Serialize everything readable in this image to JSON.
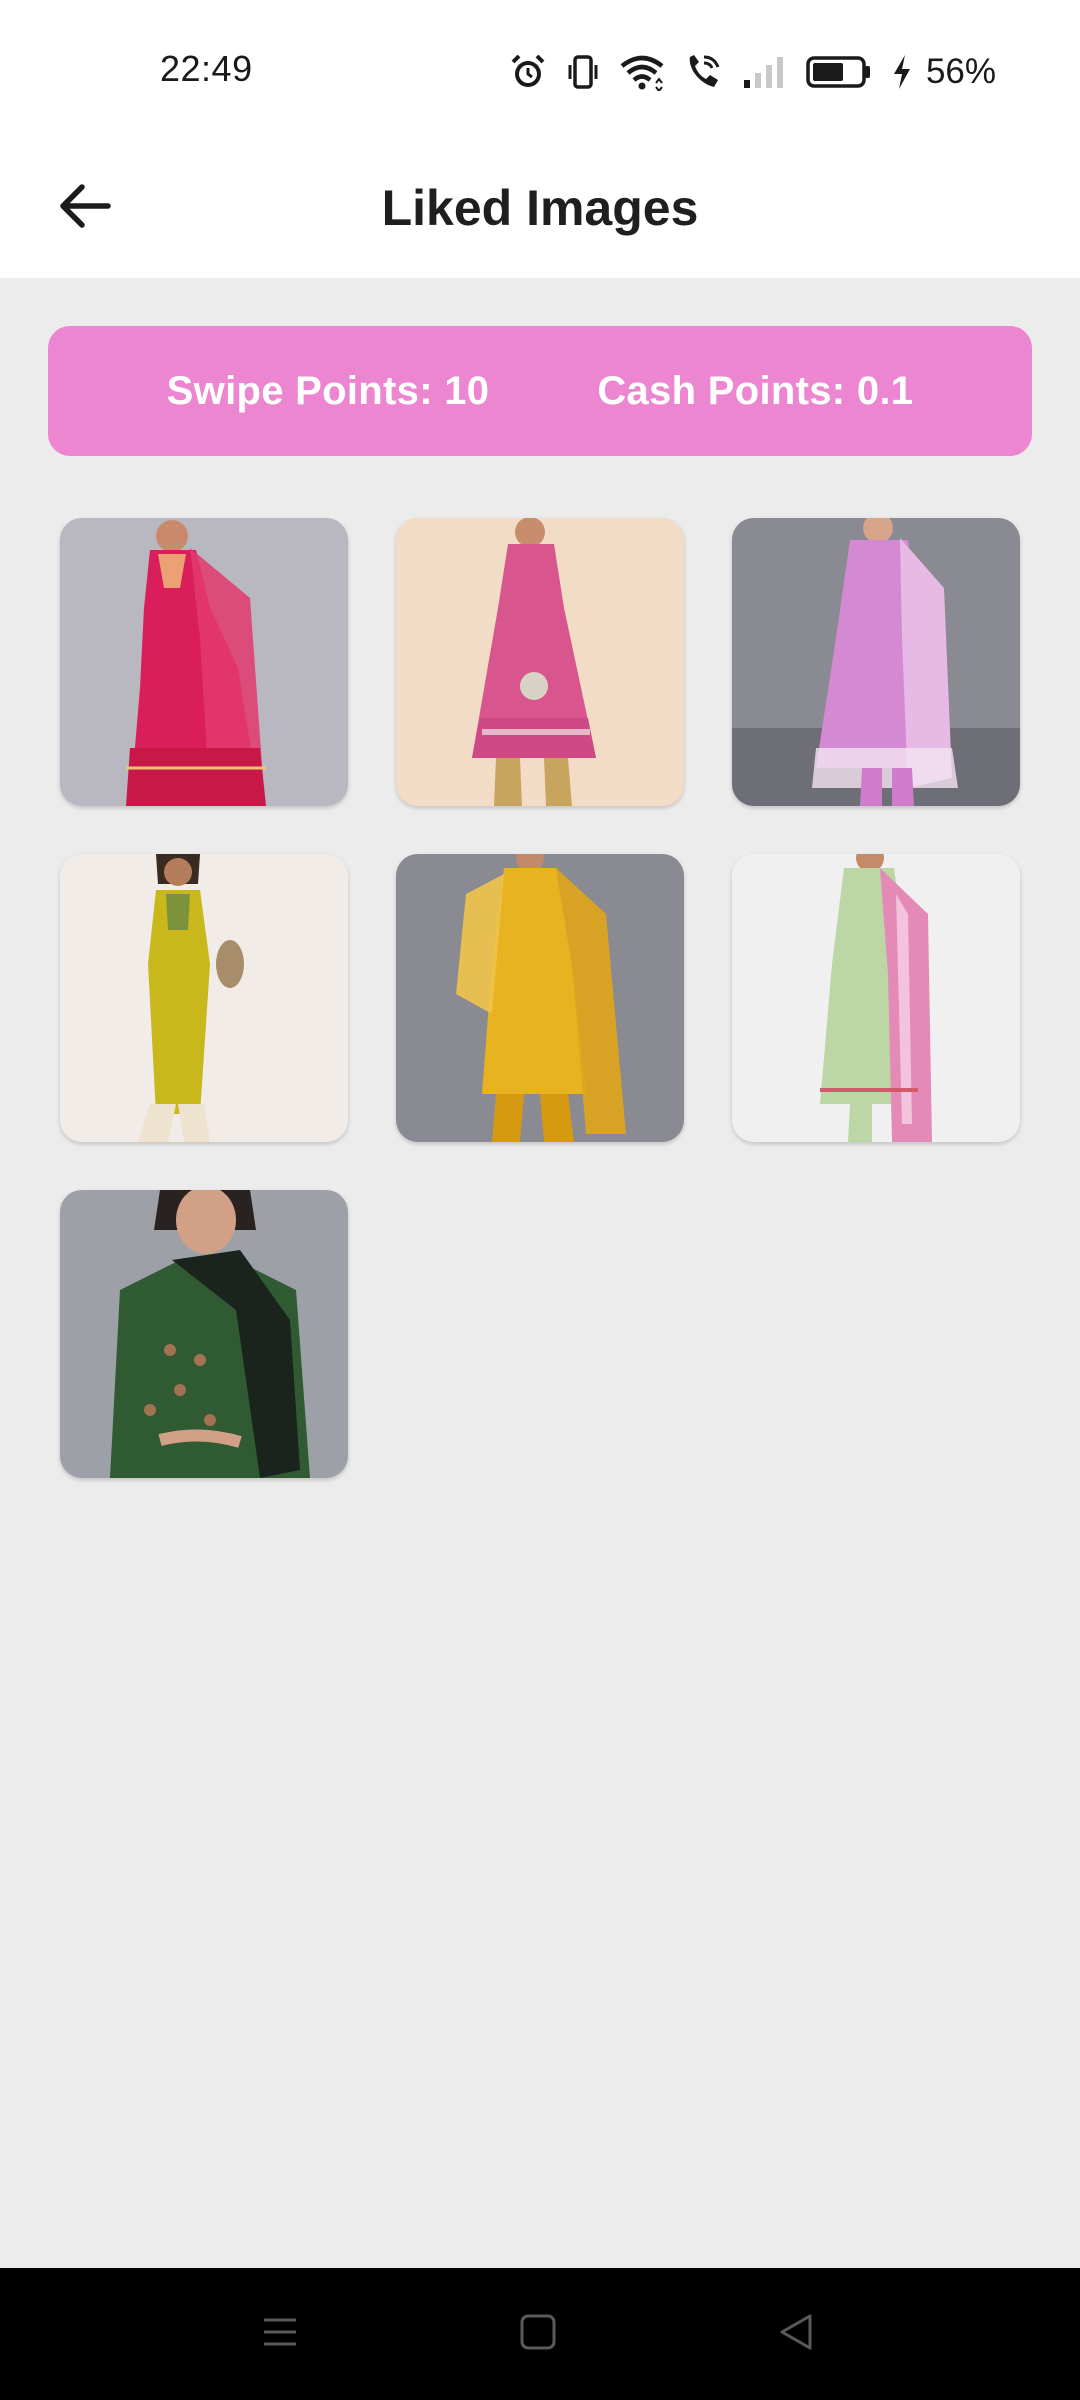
{
  "status_bar": {
    "time": "22:49",
    "battery_percent": "56%",
    "icons": [
      "alarm-icon",
      "vibrate-icon",
      "wifi-icon",
      "wifi-call-icon",
      "signal-icon",
      "battery-icon",
      "charging-icon"
    ]
  },
  "app_bar": {
    "title": "Liked Images",
    "back_icon": "arrow-left-icon"
  },
  "points": {
    "swipe": "Swipe Points: 10",
    "cash": "Cash Points: 0.1",
    "banner_color": "#ec86d1"
  },
  "liked_images": [
    {
      "name": "pink-kurta-sharara",
      "bg": "#b9b7c0",
      "main": "#d91e5b",
      "accent": "#f0c27a",
      "skin": "#c98a6b"
    },
    {
      "name": "pink-anarkali",
      "bg": "#f3dcc6",
      "main": "#d9558e",
      "accent": "#c8a55e",
      "skin": "#c78d6c"
    },
    {
      "name": "lilac-printed-suit",
      "bg": "#8a8a92",
      "main": "#d48ad2",
      "accent": "#f4e3f1",
      "skin": "#d8a58a"
    },
    {
      "name": "mustard-yellow-kurta",
      "bg": "#f1ece7",
      "main": "#c9b81c",
      "accent": "#eee3cf",
      "skin": "#b37d5c"
    },
    {
      "name": "yellow-suit-dupatta",
      "bg": "#8a8a92",
      "main": "#e8b321",
      "accent": "#d69a12",
      "skin": "#c38a6a"
    },
    {
      "name": "green-pink-printed-suit",
      "bg": "#f1f0f1",
      "main": "#bcd7a5",
      "accent": "#e48ab7",
      "skin": "#c38b6a"
    },
    {
      "name": "green-printed-kurta",
      "bg": "#9da0a6",
      "main": "#2f5a32",
      "accent": "#1b241c",
      "skin": "#d2a086"
    }
  ],
  "nav_bar": {
    "icons": [
      "menu-icon",
      "home-square-icon",
      "back-triangle-icon"
    ]
  }
}
